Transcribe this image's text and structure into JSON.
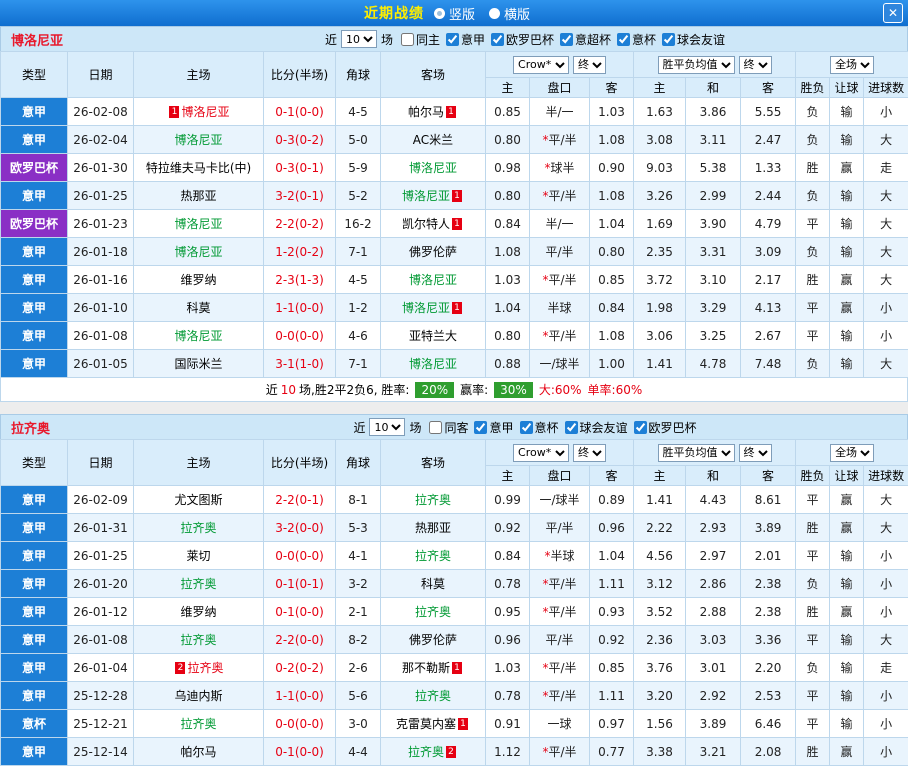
{
  "topbar": {
    "title": "近期战绩",
    "options": [
      {
        "label": "竖版",
        "selected": true
      },
      {
        "label": "横版",
        "selected": false
      }
    ],
    "close": "✕"
  },
  "colors": {
    "league_blue": "#1d7fd6",
    "league_purple": "#8a2fc5",
    "win_red": "#e60012",
    "loss_green": "#009933",
    "draw_blue": "#0033cc",
    "badge_green": "#2f9e2f"
  },
  "sections": [
    {
      "team": "博洛尼亚",
      "filters": {
        "near": "近",
        "count": "10",
        "unit": "场",
        "checks": [
          {
            "label": "同主",
            "checked": false
          },
          {
            "label": "意甲",
            "checked": true
          },
          {
            "label": "欧罗巴杯",
            "checked": true
          },
          {
            "label": "意超杯",
            "checked": true
          },
          {
            "label": "意杯",
            "checked": true
          },
          {
            "label": "球会友谊",
            "checked": true
          }
        ]
      },
      "header": {
        "type": "类型",
        "date": "日期",
        "home": "主场",
        "score": "比分(半场)",
        "corner": "角球",
        "away": "客场",
        "odds_source": "Crow*",
        "odds_final": "终",
        "odds_home": "主",
        "odds_handicap": "盘口",
        "odds_away": "客",
        "avg_source": "胜平负均值",
        "avg_final": "终",
        "avg_home": "主",
        "avg_draw": "和",
        "avg_away": "客",
        "scope": "全场",
        "result": "胜负",
        "handicap_result": "让球",
        "goals": "进球数"
      },
      "rows": [
        {
          "league": "意甲",
          "league_color": "blue",
          "date": "26-02-08",
          "home": {
            "pre": "1",
            "name": "博洛尼亚",
            "color": "red"
          },
          "score": "0-1(0-0)",
          "corner": "4-5",
          "away": {
            "name": "帕尔马",
            "post": "1",
            "color": "black"
          },
          "odds": [
            "0.85",
            "半/一",
            "1.03"
          ],
          "avg": [
            "1.63",
            "3.86",
            "5.55"
          ],
          "res": "负",
          "let": "输",
          "goal": "小"
        },
        {
          "league": "意甲",
          "league_color": "blue",
          "date": "26-02-04",
          "home": {
            "name": "博洛尼亚",
            "color": "green"
          },
          "score": "0-3(0-2)",
          "corner": "5-0",
          "away": {
            "name": "AC米兰",
            "color": "black"
          },
          "odds": [
            "0.80",
            "*平/半",
            "1.08"
          ],
          "avg": [
            "3.08",
            "3.11",
            "2.47"
          ],
          "res": "负",
          "let": "输",
          "goal": "大"
        },
        {
          "league": "欧罗巴杯",
          "league_color": "purple",
          "date": "26-01-30",
          "home": {
            "name": "特拉维夫马卡比(中)",
            "color": "black"
          },
          "score": "0-3(0-1)",
          "corner": "5-9",
          "away": {
            "name": "博洛尼亚",
            "color": "green"
          },
          "odds": [
            "0.98",
            "*球半",
            "0.90"
          ],
          "avg": [
            "9.03",
            "5.38",
            "1.33"
          ],
          "res": "胜",
          "let": "赢",
          "goal": "走"
        },
        {
          "league": "意甲",
          "league_color": "blue",
          "date": "26-01-25",
          "home": {
            "name": "热那亚",
            "color": "black"
          },
          "score": "3-2(0-1)",
          "corner": "5-2",
          "away": {
            "name": "博洛尼亚",
            "post": "1",
            "color": "green"
          },
          "odds": [
            "0.80",
            "*平/半",
            "1.08"
          ],
          "avg": [
            "3.26",
            "2.99",
            "2.44"
          ],
          "res": "负",
          "let": "输",
          "goal": "大"
        },
        {
          "league": "欧罗巴杯",
          "league_color": "purple",
          "date": "26-01-23",
          "home": {
            "name": "博洛尼亚",
            "color": "green"
          },
          "score": "2-2(0-2)",
          "corner": "16-2",
          "away": {
            "name": "凯尔特人",
            "post": "1",
            "color": "black"
          },
          "odds": [
            "0.84",
            "半/一",
            "1.04"
          ],
          "avg": [
            "1.69",
            "3.90",
            "4.79"
          ],
          "res": "平",
          "let": "输",
          "goal": "大"
        },
        {
          "league": "意甲",
          "league_color": "blue",
          "date": "26-01-18",
          "home": {
            "name": "博洛尼亚",
            "color": "green"
          },
          "score": "1-2(0-2)",
          "corner": "7-1",
          "away": {
            "name": "佛罗伦萨",
            "color": "black"
          },
          "odds": [
            "1.08",
            "平/半",
            "0.80"
          ],
          "avg": [
            "2.35",
            "3.31",
            "3.09"
          ],
          "res": "负",
          "let": "输",
          "goal": "大"
        },
        {
          "league": "意甲",
          "league_color": "blue",
          "date": "26-01-16",
          "home": {
            "name": "维罗纳",
            "color": "black"
          },
          "score": "2-3(1-3)",
          "corner": "4-5",
          "away": {
            "name": "博洛尼亚",
            "color": "green"
          },
          "odds": [
            "1.03",
            "*平/半",
            "0.85"
          ],
          "avg": [
            "3.72",
            "3.10",
            "2.17"
          ],
          "res": "胜",
          "let": "赢",
          "goal": "大"
        },
        {
          "league": "意甲",
          "league_color": "blue",
          "date": "26-01-10",
          "home": {
            "name": "科莫",
            "color": "black"
          },
          "score": "1-1(0-0)",
          "corner": "1-2",
          "away": {
            "name": "博洛尼亚",
            "post": "1",
            "color": "green"
          },
          "odds": [
            "1.04",
            "半球",
            "0.84"
          ],
          "avg": [
            "1.98",
            "3.29",
            "4.13"
          ],
          "res": "平",
          "let": "赢",
          "goal": "小"
        },
        {
          "league": "意甲",
          "league_color": "blue",
          "date": "26-01-08",
          "home": {
            "name": "博洛尼亚",
            "color": "green"
          },
          "score": "0-0(0-0)",
          "corner": "4-6",
          "away": {
            "name": "亚特兰大",
            "color": "black"
          },
          "odds": [
            "0.80",
            "*平/半",
            "1.08"
          ],
          "avg": [
            "3.06",
            "3.25",
            "2.67"
          ],
          "res": "平",
          "let": "输",
          "goal": "小"
        },
        {
          "league": "意甲",
          "league_color": "blue",
          "date": "26-01-05",
          "home": {
            "name": "国际米兰",
            "color": "black"
          },
          "score": "3-1(1-0)",
          "corner": "7-1",
          "away": {
            "name": "博洛尼亚",
            "color": "green"
          },
          "odds": [
            "0.88",
            "一/球半",
            "1.00"
          ],
          "avg": [
            "1.41",
            "4.78",
            "7.48"
          ],
          "res": "负",
          "let": "输",
          "goal": "大"
        }
      ],
      "summary": {
        "pre": "近",
        "count": "10",
        "mid1": "场,胜2平2负6, 胜率:",
        "win_rate": "20%",
        "mid2": "赢率:",
        "profit_rate": "30%",
        "big": "大:60%",
        "single": "单率:60%"
      }
    },
    {
      "team": "拉齐奥",
      "filters": {
        "near": "近",
        "count": "10",
        "unit": "场",
        "checks": [
          {
            "label": "同客",
            "checked": false
          },
          {
            "label": "意甲",
            "checked": true
          },
          {
            "label": "意杯",
            "checked": true
          },
          {
            "label": "球会友谊",
            "checked": true
          },
          {
            "label": "欧罗巴杯",
            "checked": true
          }
        ]
      },
      "header": {
        "type": "类型",
        "date": "日期",
        "home": "主场",
        "score": "比分(半场)",
        "corner": "角球",
        "away": "客场",
        "odds_source": "Crow*",
        "odds_final": "终",
        "odds_home": "主",
        "odds_handicap": "盘口",
        "odds_away": "客",
        "avg_source": "胜平负均值",
        "avg_final": "终",
        "avg_home": "主",
        "avg_draw": "和",
        "avg_away": "客",
        "scope": "全场",
        "result": "胜负",
        "handicap_result": "让球",
        "goals": "进球数"
      },
      "rows": [
        {
          "league": "意甲",
          "league_color": "blue",
          "date": "26-02-09",
          "home": {
            "name": "尤文图斯",
            "color": "black"
          },
          "score": "2-2(0-1)",
          "corner": "8-1",
          "away": {
            "name": "拉齐奥",
            "color": "green"
          },
          "odds": [
            "0.99",
            "一/球半",
            "0.89"
          ],
          "avg": [
            "1.41",
            "4.43",
            "8.61"
          ],
          "res": "平",
          "let": "赢",
          "goal": "大"
        },
        {
          "league": "意甲",
          "league_color": "blue",
          "date": "26-01-31",
          "home": {
            "name": "拉齐奥",
            "color": "green"
          },
          "score": "3-2(0-0)",
          "corner": "5-3",
          "away": {
            "name": "热那亚",
            "color": "black"
          },
          "odds": [
            "0.92",
            "平/半",
            "0.96"
          ],
          "avg": [
            "2.22",
            "2.93",
            "3.89"
          ],
          "res": "胜",
          "let": "赢",
          "goal": "大"
        },
        {
          "league": "意甲",
          "league_color": "blue",
          "date": "26-01-25",
          "home": {
            "name": "莱切",
            "color": "black"
          },
          "score": "0-0(0-0)",
          "corner": "4-1",
          "away": {
            "name": "拉齐奥",
            "color": "green"
          },
          "odds": [
            "0.84",
            "*半球",
            "1.04"
          ],
          "avg": [
            "4.56",
            "2.97",
            "2.01"
          ],
          "res": "平",
          "let": "输",
          "goal": "小"
        },
        {
          "league": "意甲",
          "league_color": "blue",
          "date": "26-01-20",
          "home": {
            "name": "拉齐奥",
            "color": "green"
          },
          "score": "0-1(0-1)",
          "corner": "3-2",
          "away": {
            "name": "科莫",
            "color": "black"
          },
          "odds": [
            "0.78",
            "*平/半",
            "1.11"
          ],
          "avg": [
            "3.12",
            "2.86",
            "2.38"
          ],
          "res": "负",
          "let": "输",
          "goal": "小"
        },
        {
          "league": "意甲",
          "league_color": "blue",
          "date": "26-01-12",
          "home": {
            "name": "维罗纳",
            "color": "black"
          },
          "score": "0-1(0-0)",
          "corner": "2-1",
          "away": {
            "name": "拉齐奥",
            "color": "green"
          },
          "odds": [
            "0.95",
            "*平/半",
            "0.93"
          ],
          "avg": [
            "3.52",
            "2.88",
            "2.38"
          ],
          "res": "胜",
          "let": "赢",
          "goal": "小"
        },
        {
          "league": "意甲",
          "league_color": "blue",
          "date": "26-01-08",
          "home": {
            "name": "拉齐奥",
            "color": "green"
          },
          "score": "2-2(0-0)",
          "corner": "8-2",
          "away": {
            "name": "佛罗伦萨",
            "color": "black"
          },
          "odds": [
            "0.96",
            "平/半",
            "0.92"
          ],
          "avg": [
            "2.36",
            "3.03",
            "3.36"
          ],
          "res": "平",
          "let": "输",
          "goal": "大"
        },
        {
          "league": "意甲",
          "league_color": "blue",
          "date": "26-01-04",
          "home": {
            "pre": "2",
            "name": "拉齐奥",
            "color": "red"
          },
          "score": "0-2(0-2)",
          "corner": "2-6",
          "away": {
            "name": "那不勒斯",
            "post": "1",
            "color": "black"
          },
          "odds": [
            "1.03",
            "*平/半",
            "0.85"
          ],
          "avg": [
            "3.76",
            "3.01",
            "2.20"
          ],
          "res": "负",
          "let": "输",
          "goal": "走"
        },
        {
          "league": "意甲",
          "league_color": "blue",
          "date": "25-12-28",
          "home": {
            "name": "乌迪内斯",
            "color": "black"
          },
          "score": "1-1(0-0)",
          "corner": "5-6",
          "away": {
            "name": "拉齐奥",
            "color": "green"
          },
          "odds": [
            "0.78",
            "*平/半",
            "1.11"
          ],
          "avg": [
            "3.20",
            "2.92",
            "2.53"
          ],
          "res": "平",
          "let": "输",
          "goal": "小"
        },
        {
          "league": "意杯",
          "league_color": "blue",
          "date": "25-12-21",
          "home": {
            "name": "拉齐奥",
            "color": "green"
          },
          "score": "0-0(0-0)",
          "corner": "3-0",
          "away": {
            "name": "克雷莫内塞",
            "post": "1",
            "color": "black"
          },
          "odds": [
            "0.91",
            "一球",
            "0.97"
          ],
          "avg": [
            "1.56",
            "3.89",
            "6.46"
          ],
          "res": "平",
          "let": "输",
          "goal": "小"
        },
        {
          "league": "意甲",
          "league_color": "blue",
          "date": "25-12-14",
          "home": {
            "name": "帕尔马",
            "color": "black"
          },
          "score": "0-1(0-0)",
          "corner": "4-4",
          "away": {
            "name": "拉齐奥",
            "post": "2",
            "color": "green"
          },
          "odds": [
            "1.12",
            "*平/半",
            "0.77"
          ],
          "avg": [
            "3.38",
            "3.21",
            "2.08"
          ],
          "res": "胜",
          "let": "赢",
          "goal": "小"
        }
      ],
      "summary": null
    }
  ]
}
